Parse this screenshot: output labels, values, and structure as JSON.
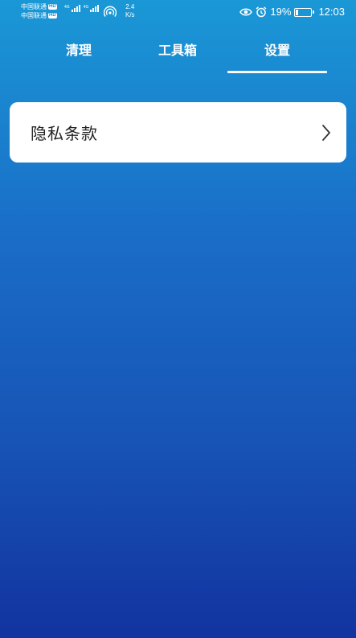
{
  "status_bar": {
    "carriers": [
      {
        "name": "中国联通",
        "badge": "HD"
      },
      {
        "name": "中国联通",
        "badge": "HD"
      }
    ],
    "signal_labels": [
      "4G",
      "4G"
    ],
    "speed_value": "2.4",
    "speed_unit": "K/s",
    "battery_percent": "19%",
    "battery_level": 0.19,
    "time": "12:03",
    "icons": [
      "eye-icon",
      "alarm-icon",
      "battery-charging-icon",
      "hotspot-icon"
    ]
  },
  "tabs": [
    {
      "label": "清理",
      "active": false
    },
    {
      "label": "工具箱",
      "active": false
    },
    {
      "label": "设置",
      "active": true
    }
  ],
  "settings": {
    "items": [
      {
        "label": "隐私条款",
        "icon": "chevron-right-icon"
      }
    ]
  },
  "colors": {
    "gradient_top": "#1a98d6",
    "gradient_bottom": "#1233a0",
    "card_bg": "#ffffff",
    "card_text": "#222222"
  }
}
